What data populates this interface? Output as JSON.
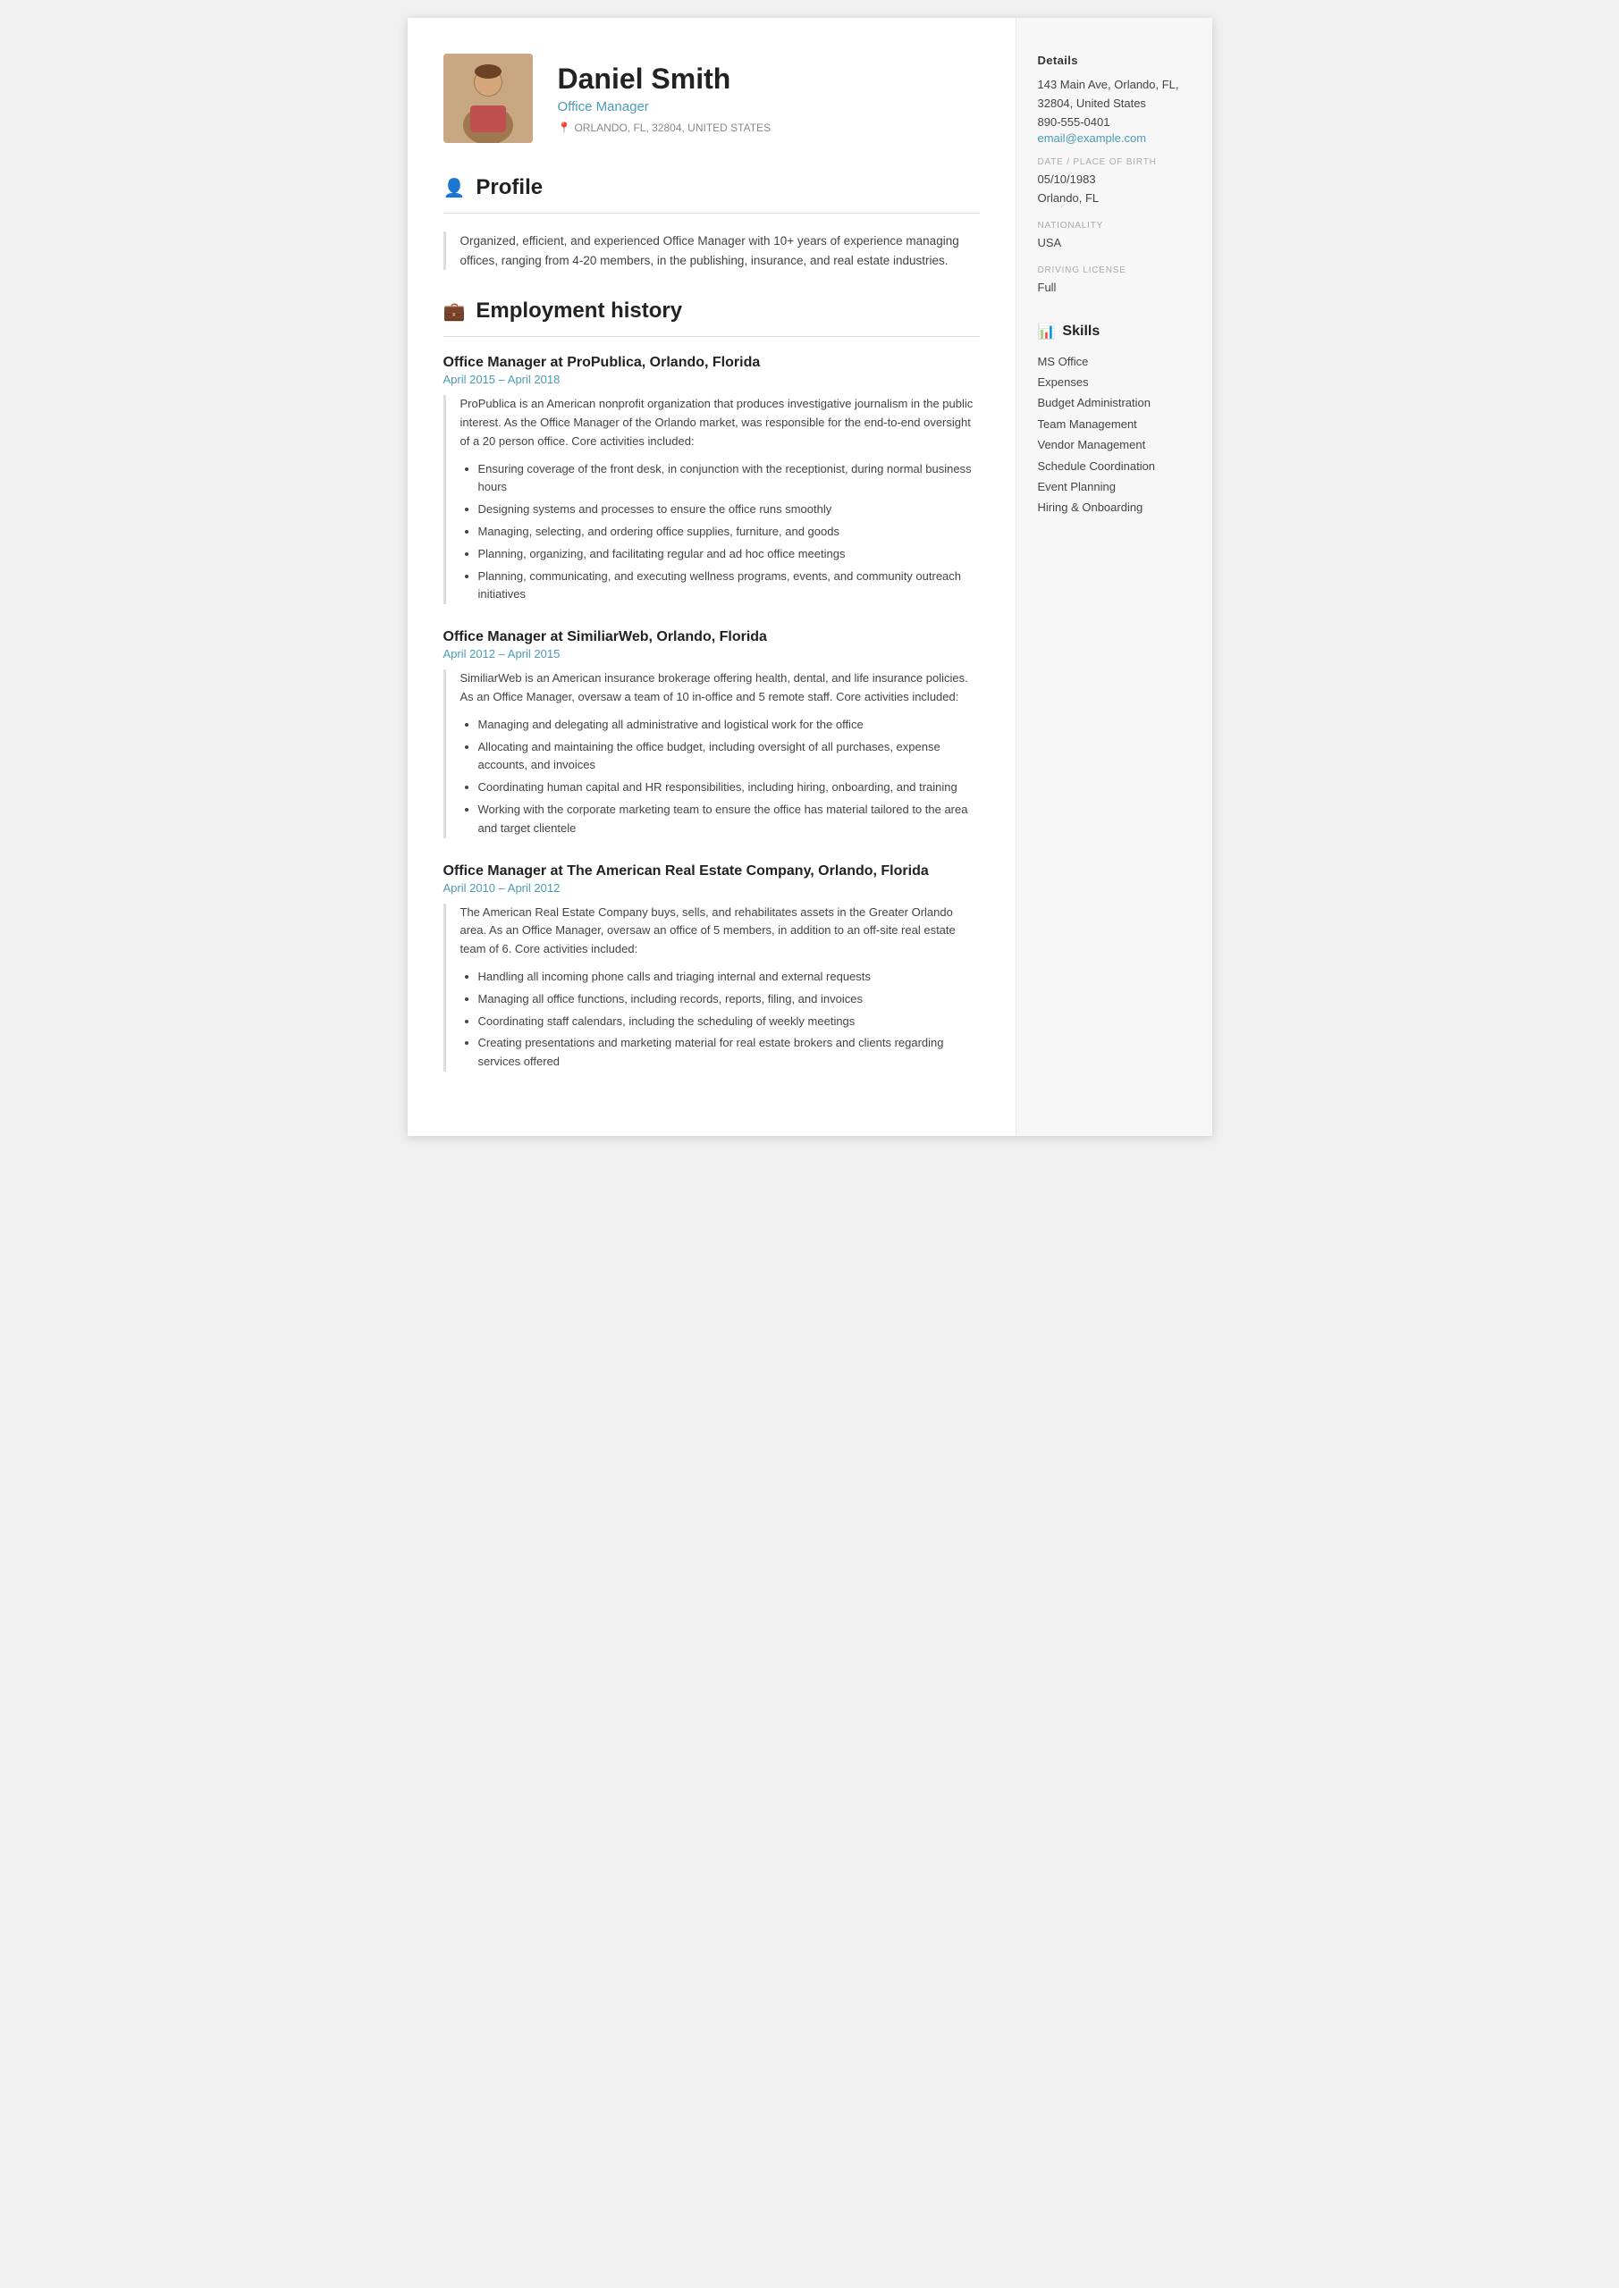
{
  "header": {
    "name": "Daniel Smith",
    "title": "Office Manager",
    "location": "ORLANDO, FL, 32804, UNITED STATES"
  },
  "sidebar": {
    "details_title": "Details",
    "address": "143 Main Ave, Orlando, FL, 32804, United States",
    "phone": "890-555-0401",
    "email": "email@example.com",
    "dob_label": "DATE / PLACE OF BIRTH",
    "dob": "05/10/1983",
    "dob_place": "Orlando, FL",
    "nationality_label": "NATIONALITY",
    "nationality": "USA",
    "driving_label": "DRIVING LICENSE",
    "driving": "Full",
    "skills_title": "Skills",
    "skills": [
      "MS Office",
      "Expenses",
      "Budget Administration",
      "Team Management",
      "Vendor Management",
      "Schedule Coordination",
      "Event Planning",
      "Hiring & Onboarding"
    ]
  },
  "profile": {
    "section_title": "Profile",
    "text": "Organized, efficient, and experienced Office Manager with 10+ years of experience managing offices, ranging from 4-20 members, in the publishing, insurance, and real estate industries."
  },
  "employment": {
    "section_title": "Employment history",
    "jobs": [
      {
        "title": "Office Manager at ProPublica, Orlando, Florida",
        "dates": "April 2015  –  April 2018",
        "description": "ProPublica is an American nonprofit organization that produces investigative journalism in the public interest. As the Office Manager of the Orlando market, was responsible for the end-to-end oversight of a 20 person office. Core activities included:",
        "bullets": [
          "Ensuring coverage of the front desk, in conjunction with the receptionist, during normal business hours",
          "Designing systems and processes to ensure the office runs smoothly",
          "Managing, selecting, and ordering office supplies, furniture, and goods",
          "Planning, organizing, and facilitating regular and ad hoc office meetings",
          "Planning, communicating, and executing wellness programs, events, and community outreach initiatives"
        ]
      },
      {
        "title": "Office Manager at SimiliarWeb, Orlando, Florida",
        "dates": "April 2012  –  April 2015",
        "description": "SimiliarWeb is an American insurance brokerage offering health, dental, and life insurance policies. As an Office Manager, oversaw a team of 10 in-office and 5 remote staff. Core activities included:",
        "bullets": [
          "Managing and delegating all administrative and logistical work for the office",
          "Allocating and maintaining the office budget, including oversight of all purchases, expense accounts, and invoices",
          "Coordinating human capital and HR responsibilities, including hiring, onboarding, and training",
          "Working with the corporate marketing team to ensure the office has material tailored to the area and target clientele"
        ]
      },
      {
        "title": "Office Manager at The American Real Estate Company, Orlando, Florida",
        "dates": "April 2010  –  April 2012",
        "description": "The American Real Estate Company buys, sells, and rehabilitates assets in the Greater Orlando area. As an Office Manager, oversaw an office of 5 members, in addition to an off-site real estate team of 6. Core activities included:",
        "bullets": [
          "Handling all incoming phone calls and triaging internal and external requests",
          "Managing all office functions, including records, reports, filing, and invoices",
          "Coordinating staff calendars, including the scheduling of weekly meetings",
          "Creating presentations and marketing material for real estate brokers and clients regarding services offered"
        ]
      }
    ]
  }
}
